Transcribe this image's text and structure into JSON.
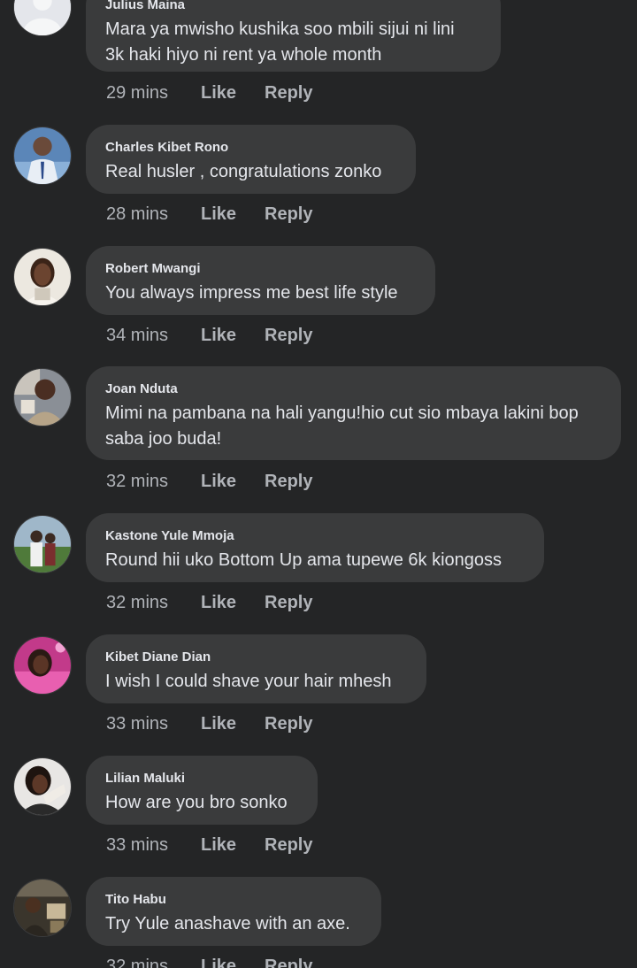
{
  "comments": [
    {
      "author": "Julius Maina",
      "text": "Mara ya mwisho kushika soo mbili sijui ni lini\n3k haki hiyo ni rent ya whole month",
      "time": "29 mins",
      "like_label": "Like",
      "reply_label": "Reply"
    },
    {
      "author": "Charles Kibet Rono",
      "text": "Real husler , congratulations zonko",
      "time": "28 mins",
      "like_label": "Like",
      "reply_label": "Reply"
    },
    {
      "author": "Robert Mwangi",
      "text": "You always impress me best life style",
      "time": "34 mins",
      "like_label": "Like",
      "reply_label": "Reply"
    },
    {
      "author": "Joan Nduta",
      "text": "Mimi na pambana na hali yangu!hio cut sio mbaya lakini bop\nsaba joo buda!",
      "time": "32 mins",
      "like_label": "Like",
      "reply_label": "Reply"
    },
    {
      "author": "Kastone Yule Mmoja",
      "text": "Round hii uko Bottom Up ama tupewe 6k kiongoss",
      "time": "32 mins",
      "like_label": "Like",
      "reply_label": "Reply"
    },
    {
      "author": "Kibet Diane Dian",
      "text": "I wish I could shave your hair mhesh",
      "time": "33 mins",
      "like_label": "Like",
      "reply_label": "Reply"
    },
    {
      "author": "Lilian Maluki",
      "text": "How are you bro sonko",
      "time": "33 mins",
      "like_label": "Like",
      "reply_label": "Reply"
    },
    {
      "author": "Tito Habu",
      "text": "Try Yule anashave with an axe.",
      "time": "32 mins",
      "like_label": "Like",
      "reply_label": "Reply"
    }
  ]
}
